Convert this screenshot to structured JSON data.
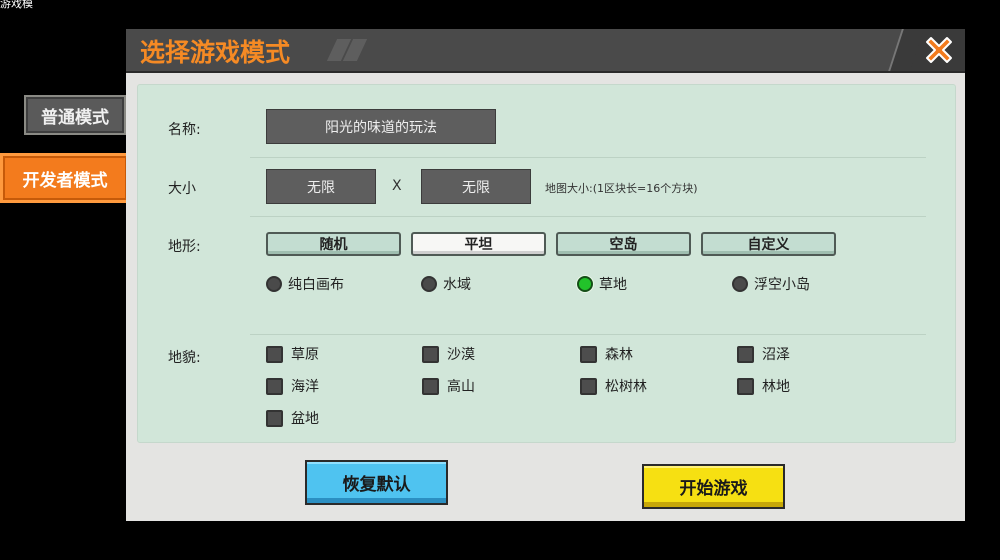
{
  "corner_text": "游戏模",
  "side_tabs": {
    "normal": "普通模式",
    "developer": "开发者模式"
  },
  "dialog": {
    "title": "选择游戏模式",
    "close_icon": "close-x-icon",
    "close_color": "#f37b1d"
  },
  "form": {
    "name_label": "名称:",
    "name_value": "阳光的味道的玩法",
    "size_label": "大小",
    "size_width": "无限",
    "size_separator": "X",
    "size_height": "无限",
    "map_size_note": "地图大小:(1区块长=16个方块)",
    "terrain_label": "地形:",
    "terrain_types": [
      "随机",
      "平坦",
      "空岛",
      "自定义"
    ],
    "terrain_selected_type": "平坦",
    "terrain_options": [
      "纯白画布",
      "水域",
      "草地",
      "浮空小岛"
    ],
    "terrain_selected_option": "草地",
    "landform_label": "地貌:",
    "landforms": [
      "草原",
      "沙漠",
      "森林",
      "沼泽",
      "海洋",
      "高山",
      "松树林",
      "林地",
      "盆地"
    ]
  },
  "buttons": {
    "restore": "恢复默认",
    "start": "开始游戏"
  },
  "colors": {
    "accent_orange": "#f37b1d",
    "panel_green": "#d1e6d9",
    "restore_blue": "#4fc3f0",
    "start_yellow": "#f6e012",
    "radio_on": "#22c32a"
  }
}
